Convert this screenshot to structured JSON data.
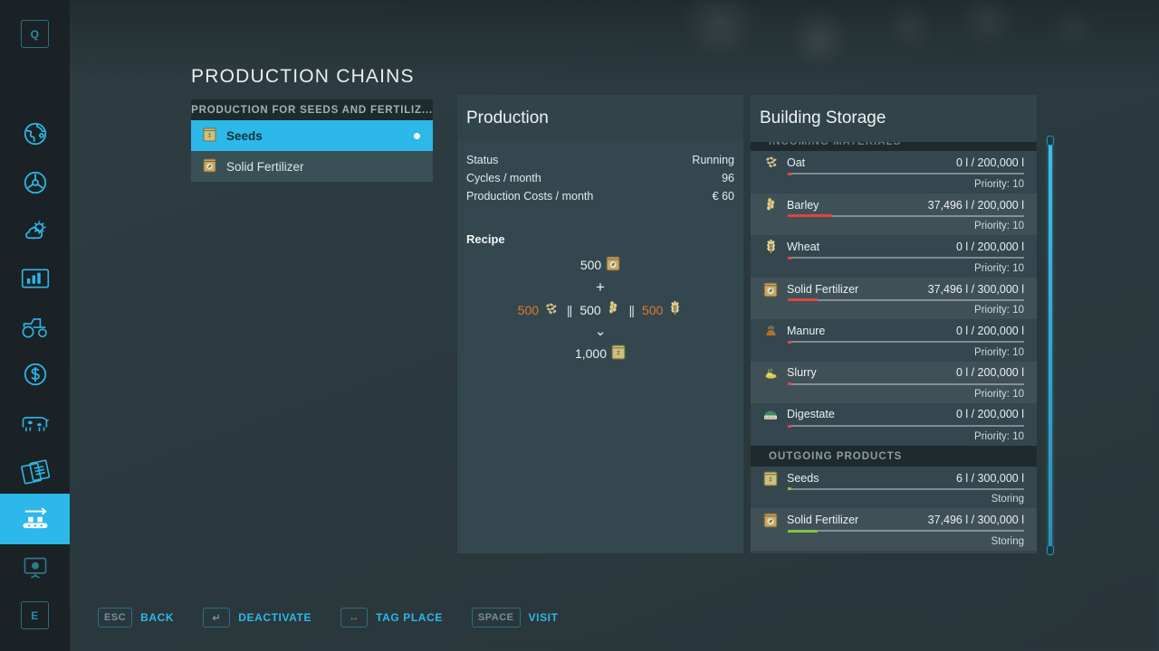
{
  "page": {
    "title": "PRODUCTION CHAINS"
  },
  "sidebar": {
    "top_key": "Q",
    "bottom_key": "E",
    "items": [
      {
        "icon": "globe-map-icon",
        "label": "Map",
        "active": false
      },
      {
        "icon": "steering-wheel-icon",
        "label": "Vehicles",
        "active": false
      },
      {
        "icon": "weather-icon",
        "label": "Weather",
        "active": false
      },
      {
        "icon": "statistics-icon",
        "label": "Statistics",
        "active": false
      },
      {
        "icon": "tractor-icon",
        "label": "Garage",
        "active": false
      },
      {
        "icon": "dollar-icon",
        "label": "Finances",
        "active": false
      },
      {
        "icon": "cow-icon",
        "label": "Animals",
        "active": false
      },
      {
        "icon": "contracts-icon",
        "label": "Contracts",
        "active": false
      },
      {
        "icon": "production-icon",
        "label": "Production Chains",
        "active": true
      },
      {
        "icon": "presentation-icon",
        "label": "Tutorial",
        "active": false
      }
    ]
  },
  "production_list": {
    "header": "PRODUCTION FOR SEEDS AND FERTILIZ...",
    "items": [
      {
        "name": "Seeds",
        "icon": "seeds-bag-icon",
        "selected": true,
        "active_dot": true
      },
      {
        "name": "Solid Fertilizer",
        "icon": "fertilizer-bag-icon",
        "selected": false,
        "active_dot": false
      }
    ]
  },
  "production": {
    "title": "Production",
    "stats": [
      {
        "label": "Status",
        "value": "Running"
      },
      {
        "label": "Cycles / month",
        "value": "96"
      },
      {
        "label": "Production Costs / month",
        "value": "€ 60"
      }
    ],
    "recipe_title": "Recipe",
    "recipe": {
      "input_primary": {
        "amount": "500",
        "icon": "fertilizer-bag-icon",
        "low": false
      },
      "plus": "+",
      "alternatives": [
        {
          "amount": "500",
          "icon": "oat-icon",
          "low": true
        },
        {
          "amount": "500",
          "icon": "barley-icon",
          "low": false
        },
        {
          "amount": "500",
          "icon": "wheat-icon",
          "low": true
        }
      ],
      "separator": "||",
      "arrow": "⌄",
      "output": {
        "amount": "1,000",
        "icon": "seeds-bag-icon"
      }
    }
  },
  "storage": {
    "title": "Building Storage",
    "incoming_header": "INCOMING MATERIALS",
    "outgoing_header": "OUTGOING PRODUCTS",
    "incoming": [
      {
        "name": "Oat",
        "icon": "oat-icon",
        "amount": "0 l / 200,000 l",
        "fill_pct": 1,
        "bar": "low",
        "sub": "Priority: 10"
      },
      {
        "name": "Barley",
        "icon": "barley-icon",
        "amount": "37,496 l / 200,000 l",
        "fill_pct": 18.7,
        "bar": "low",
        "sub": "Priority: 10"
      },
      {
        "name": "Wheat",
        "icon": "wheat-icon",
        "amount": "0 l / 200,000 l",
        "fill_pct": 1,
        "bar": "low",
        "sub": "Priority: 10"
      },
      {
        "name": "Solid Fertilizer",
        "icon": "fertilizer-bag-icon",
        "amount": "37,496 l / 300,000 l",
        "fill_pct": 12.5,
        "bar": "low",
        "sub": "Priority: 10"
      },
      {
        "name": "Manure",
        "icon": "manure-icon",
        "amount": "0 l / 200,000 l",
        "fill_pct": 1,
        "bar": "low",
        "sub": "Priority: 10"
      },
      {
        "name": "Slurry",
        "icon": "slurry-icon",
        "amount": "0 l / 200,000 l",
        "fill_pct": 1,
        "bar": "low",
        "sub": "Priority: 10"
      },
      {
        "name": "Digestate",
        "icon": "digestate-icon",
        "amount": "0 l / 200,000 l",
        "fill_pct": 1,
        "bar": "low",
        "sub": "Priority: 10"
      }
    ],
    "outgoing": [
      {
        "name": "Seeds",
        "icon": "seeds-bag-icon",
        "amount": "6 l / 300,000 l",
        "fill_pct": 1,
        "bar": "good",
        "sub": "Storing"
      },
      {
        "name": "Solid Fertilizer",
        "icon": "fertilizer-bag-icon",
        "amount": "37,496 l / 300,000 l",
        "fill_pct": 12.5,
        "bar": "good",
        "sub": "Storing"
      }
    ]
  },
  "helpbar": [
    {
      "key": "ESC",
      "label": "BACK"
    },
    {
      "key": "↵",
      "label": "DEACTIVATE"
    },
    {
      "key": "↔",
      "label": "TAG PLACE"
    },
    {
      "key": "SPACE",
      "label": "VISIT"
    }
  ],
  "colors": {
    "accent": "#2cb8e8",
    "panel": "#34474e",
    "background": "#2c3b40",
    "bar_low": "#e2443f",
    "bar_good": "#7fc24a",
    "amount_low": "#e07b2e"
  }
}
